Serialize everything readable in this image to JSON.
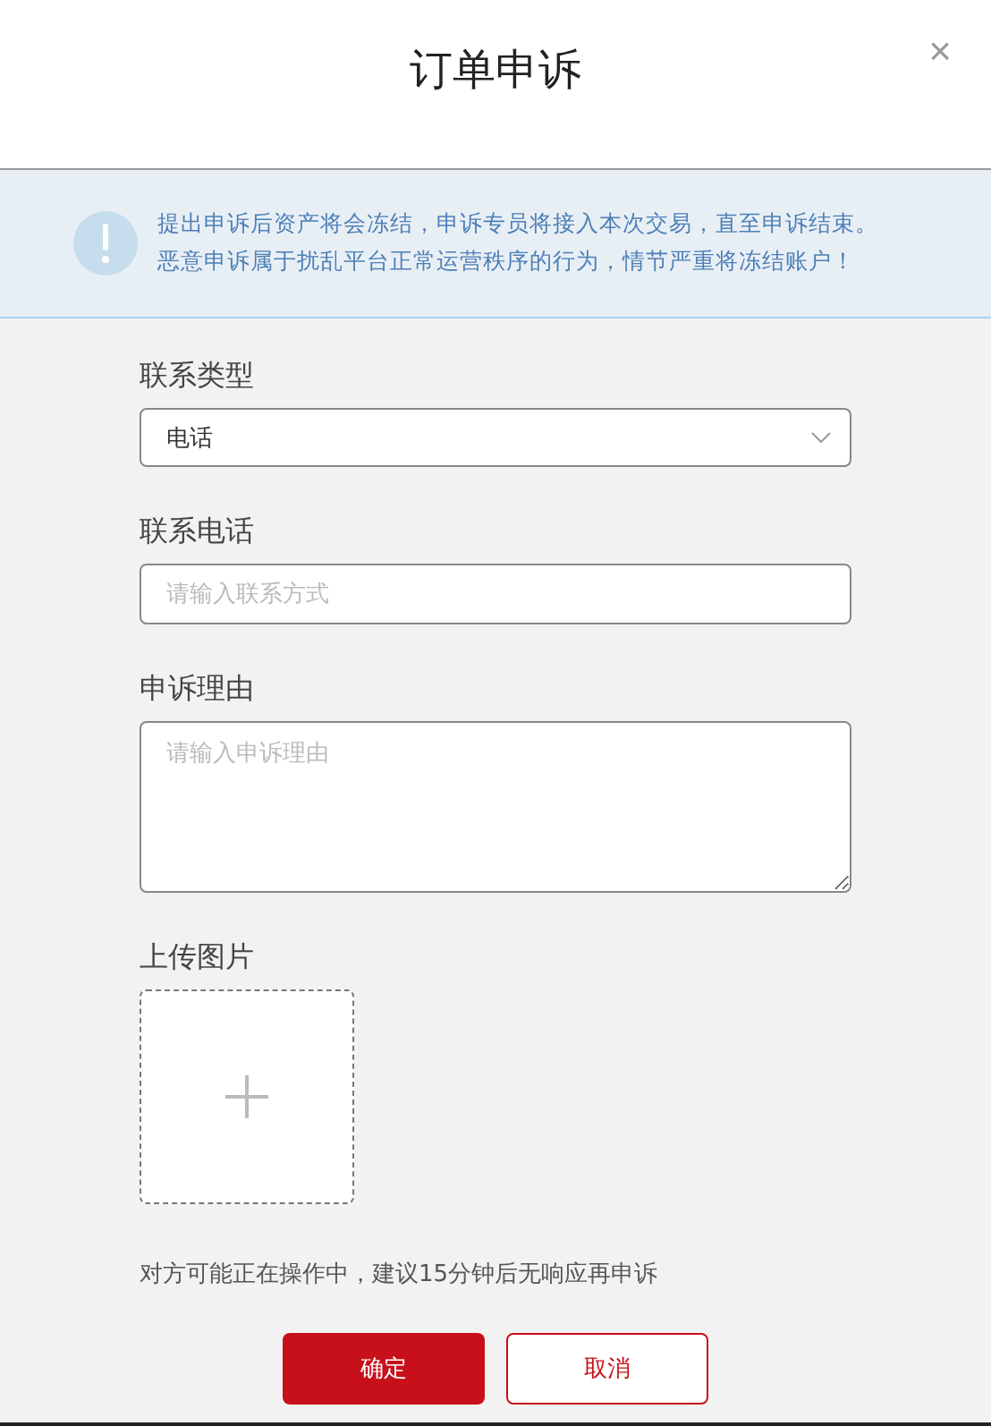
{
  "dialog": {
    "title": "订单申诉",
    "close": "×"
  },
  "notice": {
    "lines": [
      "提出申诉后资产将会冻结，申诉专员将接入本次交易，直至申诉结束。",
      "恶意申诉属于扰乱平台正常运营秩序的行为，情节严重将冻结账户！"
    ]
  },
  "fields": [
    {
      "kind": "select",
      "label": "联系类型",
      "value": "电话"
    },
    {
      "kind": "input",
      "label": "联系电话",
      "placeholder": "请输入联系方式"
    },
    {
      "kind": "textarea",
      "label": "申诉理由",
      "placeholder": "请输入申诉理由"
    },
    {
      "kind": "upload",
      "label": "上传图片"
    }
  ],
  "hint": "对方可能正在操作中，建议15分钟后无响应再申诉",
  "buttons": [
    {
      "kind": "primary",
      "label": "确定"
    },
    {
      "kind": "secondary",
      "label": "取消"
    }
  ]
}
